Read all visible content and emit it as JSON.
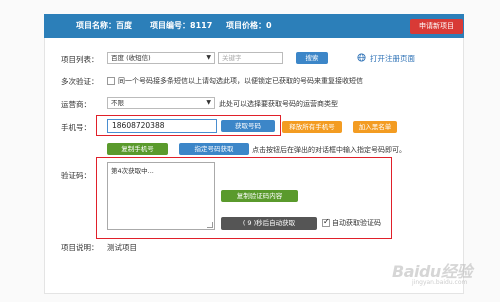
{
  "header": {
    "project_name": "项目名称：百度",
    "project_id": "项目编号：8117",
    "project_price": "项目价格：0",
    "new_project_button": "申请新项目"
  },
  "form": {
    "project_list_label": "项目列表：",
    "project_select_value": "百度 (收短信)",
    "keyword_placeholder": "关键字",
    "search_button": "搜索",
    "open_register_link": "打开注册页面",
    "multi_verify_label": "多次验证：",
    "multi_verify_text": "同一个号码接多条短信以上请勾选此项，以便锁定已获取的号码来重复接收短信",
    "carrier_label": "运营商：",
    "carrier_select_value": "不限",
    "carrier_hint": "此处可以选择要获取号码的运营商类型",
    "phone_label": "手机号：",
    "phone_value": "18608720388",
    "get_number_button": "获取号码",
    "release_all_button": "释放所有手机号",
    "add_blacklist_button": "加入黑名单",
    "copy_phone_button": "复制手机号",
    "specify_number_button": "指定号码获取",
    "specify_hint": "点击按钮后在弹出的对话框中输入指定号码即可。",
    "code_label": "验证码：",
    "code_textarea_value": "第4次获取中...",
    "copy_code_button": "复制验证码内容",
    "auto_fetch_countdown": "( 9 )秒后自动获取",
    "auto_fetch_label": "自动获取验证码",
    "project_desc_label": "项目说明：",
    "project_desc_value": "测试项目"
  },
  "watermark": {
    "main": "Baidu经验",
    "sub": "jingyan.baidu.com"
  },
  "colors": {
    "header_bg": "#2c7fb9",
    "red_button": "#d83a36",
    "blue_button": "#3c86c8",
    "green_button": "#5a9a2c",
    "orange_button": "#f39c22",
    "highlight_box": "#e0202a"
  }
}
